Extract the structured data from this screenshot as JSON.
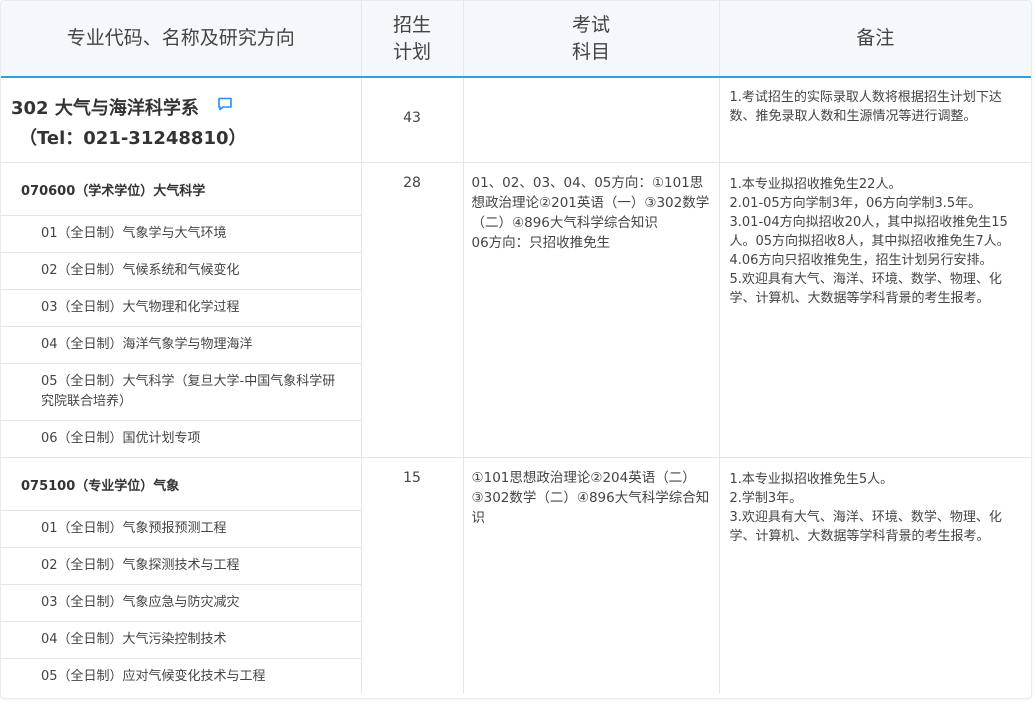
{
  "headers": {
    "col1": "专业代码、名称及研究方向",
    "col2_line1": "招生",
    "col2_line2": "计划",
    "col3_line1": "考试",
    "col3_line2": "科目",
    "col4": "备注"
  },
  "department": {
    "name": "302 大气与海洋科学系",
    "tel": "（Tel：021-31248810）",
    "plan": "43",
    "note": "1.考试招生的实际录取人数将根据招生计划下达数、推免录取人数和生源情况等进行调整。"
  },
  "majors": [
    {
      "title": "070600（学术学位）大气科学",
      "plan": "28",
      "subjects": [
        "01、02、03、04、05方向：①101思想政治理论②201英语（一）③302数学（二）④896大气科学综合知识",
        "06方向：只招收推免生"
      ],
      "notes": [
        "1.本专业拟招收推免生22人。",
        "2.01-05方向学制3年，06方向学制3.5年。",
        "3.01-04方向拟招收20人，其中拟招收推免生15人。05方向拟招收8人，其中拟招收推免生7人。",
        "4.06方向只招收推免生，招生计划另行安排。",
        "5.欢迎具有大气、海洋、环境、数学、物理、化学、计算机、大数据等学科背景的考生报考。"
      ],
      "directions": [
        "01（全日制）气象学与大气环境",
        "02（全日制）气候系统和气候变化",
        "03（全日制）大气物理和化学过程",
        "04（全日制）海洋气象学与物理海洋",
        "05（全日制）大气科学（复旦大学-中国气象科学研究院联合培养）",
        "06（全日制）国优计划专项"
      ]
    },
    {
      "title": "075100（专业学位）气象",
      "plan": "15",
      "subjects": [
        "①101思想政治理论②204英语（二）③302数学（二）④896大气科学综合知识"
      ],
      "notes": [
        "1.本专业拟招收推免生5人。",
        "2.学制3年。",
        "3.欢迎具有大气、海洋、环境、数学、物理、化学、计算机、大数据等学科背景的考生报考。"
      ],
      "directions": [
        "01（全日制）气象预报预测工程",
        "02（全日制）气象探测技术与工程",
        "03（全日制）气象应急与防灾减灾",
        "04（全日制）大气污染控制技术",
        "05（全日制）应对气候变化技术与工程"
      ]
    }
  ],
  "icons": {
    "comment": "chat-bubble-icon"
  },
  "colors": {
    "accent": "#2aa3d6",
    "icon": "#1e90ff"
  }
}
